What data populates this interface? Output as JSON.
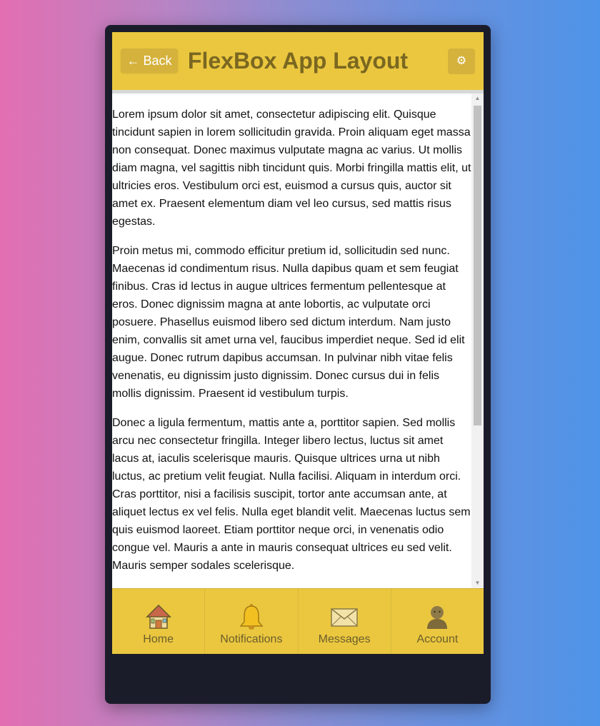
{
  "header": {
    "back_label": "← Back",
    "title": "FlexBox App Layout",
    "settings_icon": "gear-icon",
    "settings_glyph": "⚙"
  },
  "content": {
    "paragraphs": [
      "Lorem ipsum dolor sit amet, consectetur adipiscing elit. Quisque tincidunt sapien in lorem sollicitudin gravida. Proin aliquam eget massa non consequat. Donec maximus vulputate magna ac varius. Ut mollis diam magna, vel sagittis nibh tincidunt quis. Morbi fringilla mattis elit, ut ultricies eros. Vestibulum orci est, euismod a cursus quis, auctor sit amet ex. Praesent elementum diam vel leo cursus, sed mattis risus egestas.",
      "Proin metus mi, commodo efficitur pretium id, sollicitudin sed nunc. Maecenas id condimentum risus. Nulla dapibus quam et sem feugiat finibus. Cras id lectus in augue ultrices fermentum pellentesque at eros. Donec dignissim magna at ante lobortis, ac vulputate orci posuere. Phasellus euismod libero sed dictum interdum. Nam justo enim, convallis sit amet urna vel, faucibus imperdiet neque. Sed id elit augue. Donec rutrum dapibus accumsan. In pulvinar nibh vitae felis venenatis, eu dignissim justo dignissim. Donec cursus dui in felis mollis dignissim. Praesent id vestibulum turpis.",
      "Donec a ligula fermentum, mattis ante a, porttitor sapien. Sed mollis arcu nec consectetur fringilla. Integer libero lectus, luctus sit amet lacus at, iaculis scelerisque mauris. Quisque ultrices urna ut nibh luctus, ac pretium velit feugiat. Nulla facilisi. Aliquam in interdum orci. Cras porttitor, nisi a facilisis suscipit, tortor ante accumsan ante, at aliquet lectus ex vel felis. Nulla eget blandit velit. Maecenas luctus sem quis euismod laoreet. Etiam porttitor neque orci, in venenatis odio congue vel. Mauris a ante in mauris consequat ultrices eu sed velit. Mauris semper sodales scelerisque."
    ]
  },
  "tabs": [
    {
      "label": "Home",
      "icon": "house-icon"
    },
    {
      "label": "Notifications",
      "icon": "bell-icon"
    },
    {
      "label": "Messages",
      "icon": "envelope-icon"
    },
    {
      "label": "Account",
      "icon": "person-icon"
    }
  ],
  "colors": {
    "accent": "#ebc73f",
    "title_text": "#7a6721",
    "button_bg": "#d5b23c",
    "device_frame": "#1b1c2a"
  }
}
